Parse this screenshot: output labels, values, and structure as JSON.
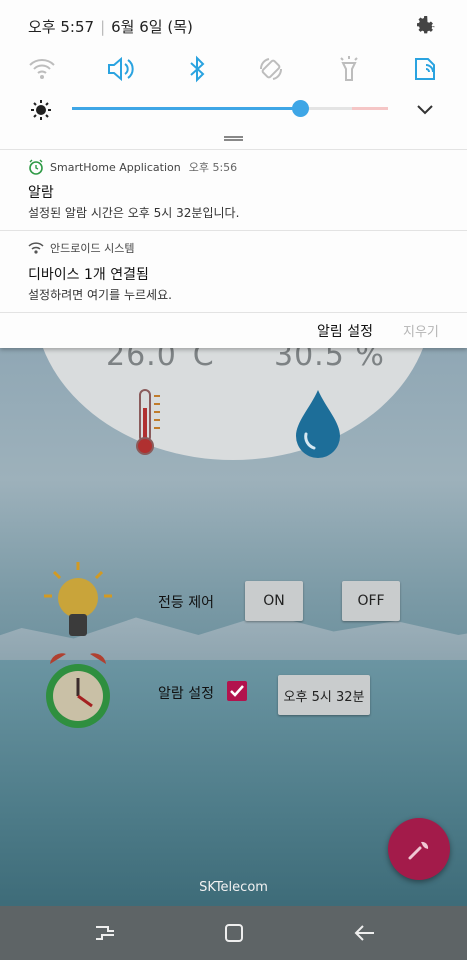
{
  "status_bar": {
    "time": "오후 5:57",
    "date": "6월 6일 (목)"
  },
  "quick_settings": {
    "icons": [
      "wifi-icon",
      "volume-icon",
      "bluetooth-icon",
      "auto-rotate-icon",
      "flashlight-icon",
      "secure-folder-icon"
    ],
    "active_color": "#2aa3e0",
    "inactive_color": "#bdbdbd",
    "brightness_level": 0.72
  },
  "notifications": [
    {
      "app": "SmartHome Application",
      "time": "오후 5:56",
      "title": "알람",
      "body": "설정된 알람 시간은 오후 5시 32분입니다."
    },
    {
      "app": "안드로이드 시스템",
      "title": "디바이스 1개 연결됨",
      "body": "설정하려면 여기를 누르세요."
    }
  ],
  "actions": {
    "settings": "알림 설정",
    "clear": "지우기"
  },
  "app": {
    "temperature": "26.0˚C",
    "humidity": "30.5 %",
    "light_label": "전등 제어",
    "on_label": "ON",
    "off_label": "OFF",
    "alarm_label": "알람 설정",
    "alarm_checked": true,
    "alarm_time": "오후 5시 32분",
    "carrier": "SKTelecom"
  },
  "colors": {
    "accent": "#a31b4a",
    "blue": "#2aa3e0"
  }
}
